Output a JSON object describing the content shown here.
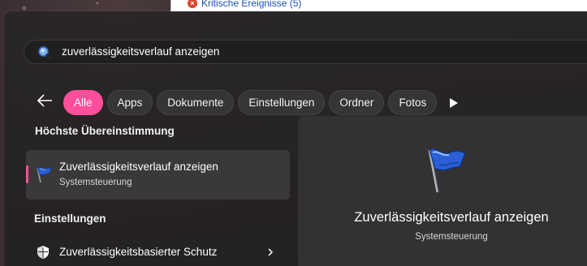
{
  "background_window": {
    "item_label": "Kritische Ereignisse (5)",
    "icon": "error-icon"
  },
  "search": {
    "value": "zuverlässigkeitsverlauf anzeigen",
    "icon": "search-icon"
  },
  "filters": {
    "back_icon": "back-arrow-icon",
    "more_icon": "play-more-icon",
    "items": [
      {
        "label": "Alle",
        "active": true
      },
      {
        "label": "Apps",
        "active": false
      },
      {
        "label": "Dokumente",
        "active": false
      },
      {
        "label": "Einstellungen",
        "active": false
      },
      {
        "label": "Ordner",
        "active": false
      },
      {
        "label": "Fotos",
        "active": false
      }
    ]
  },
  "best_match": {
    "heading": "Höchste Übereinstimmung",
    "title": "Zuverlässigkeitsverlauf anzeigen",
    "subtitle": "Systemsteuerung",
    "icon": "blue-flag-icon"
  },
  "settings_section": {
    "heading": "Einstellungen",
    "items": [
      {
        "label": "Zuverlässigkeitsbasierter Schutz",
        "icon": "shield-icon"
      }
    ]
  },
  "detail": {
    "title": "Zuverlässigkeitsverlauf anzeigen",
    "subtitle": "Systemsteuerung",
    "icon": "blue-flag-icon"
  },
  "colors": {
    "accent": "#ff4f9a",
    "panel": "#292628",
    "detail_panel": "#333132"
  }
}
